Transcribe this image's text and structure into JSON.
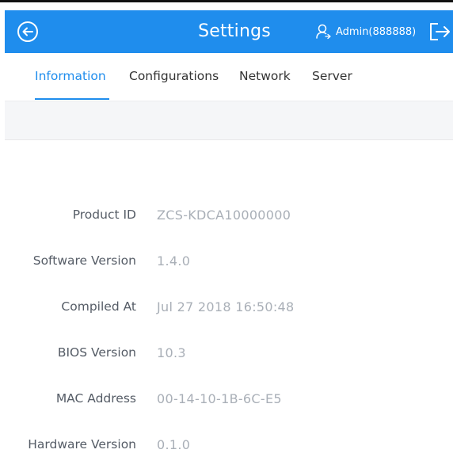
{
  "header": {
    "title": "Settings",
    "user_label": "Admin(888888)"
  },
  "tabs": [
    {
      "label": "Information",
      "active": true
    },
    {
      "label": "Configurations",
      "active": false
    },
    {
      "label": "Network",
      "active": false
    },
    {
      "label": "Server",
      "active": false
    }
  ],
  "info": [
    {
      "label": "Product ID",
      "value": "ZCS-KDCA10000000"
    },
    {
      "label": "Software Version",
      "value": "1.4.0"
    },
    {
      "label": "Compiled At",
      "value": "Jul 27 2018 16:50:48"
    },
    {
      "label": "BIOS Version",
      "value": "10.3"
    },
    {
      "label": "MAC Address",
      "value": "00-14-10-1B-6C-E5"
    },
    {
      "label": "Hardware Version",
      "value": "0.1.0"
    }
  ],
  "colors": {
    "accent": "#1f8ded",
    "label_text": "#555c66",
    "value_text": "#a9afb7"
  },
  "icons": {
    "back": "back-circle-icon",
    "user": "user-icon",
    "logout": "logout-icon"
  }
}
